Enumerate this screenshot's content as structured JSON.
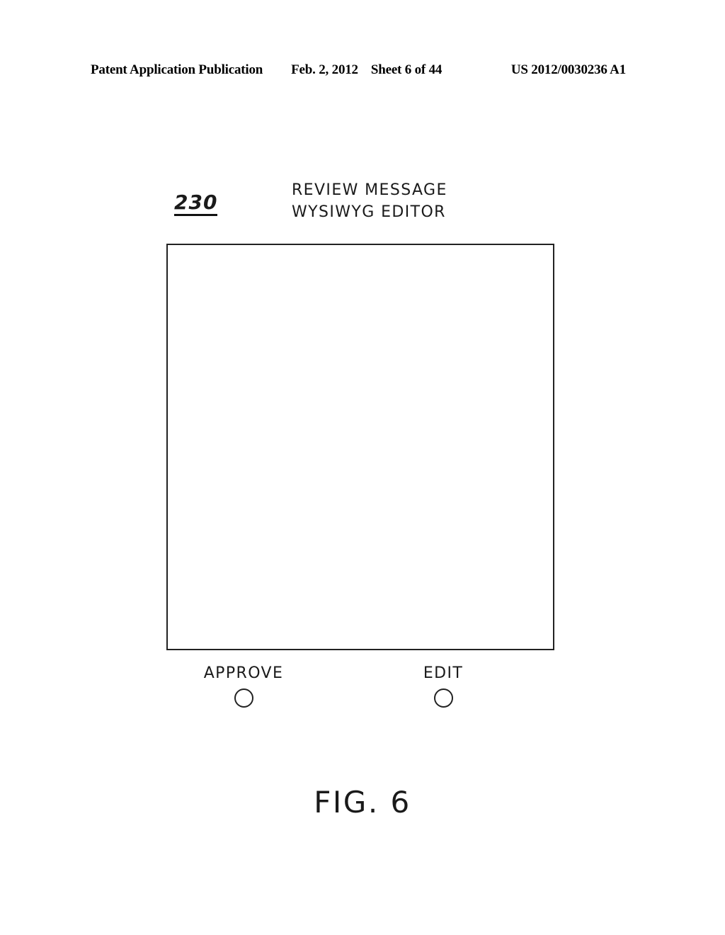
{
  "header": {
    "publication": "Patent Application Publication",
    "date": "Feb. 2, 2012",
    "sheet": "Sheet 6 of 44",
    "document_number": "US 2012/0030236 A1"
  },
  "figure": {
    "reference_numeral": "230",
    "title_line_1": "REVIEW MESSAGE",
    "title_line_2": "WYSIWYG EDITOR",
    "editor_panel": {
      "content": ""
    },
    "controls": [
      {
        "label": "APPROVE",
        "type": "radio",
        "selected": false
      },
      {
        "label": "EDIT",
        "type": "radio",
        "selected": false
      }
    ],
    "caption": "FIG. 6"
  }
}
